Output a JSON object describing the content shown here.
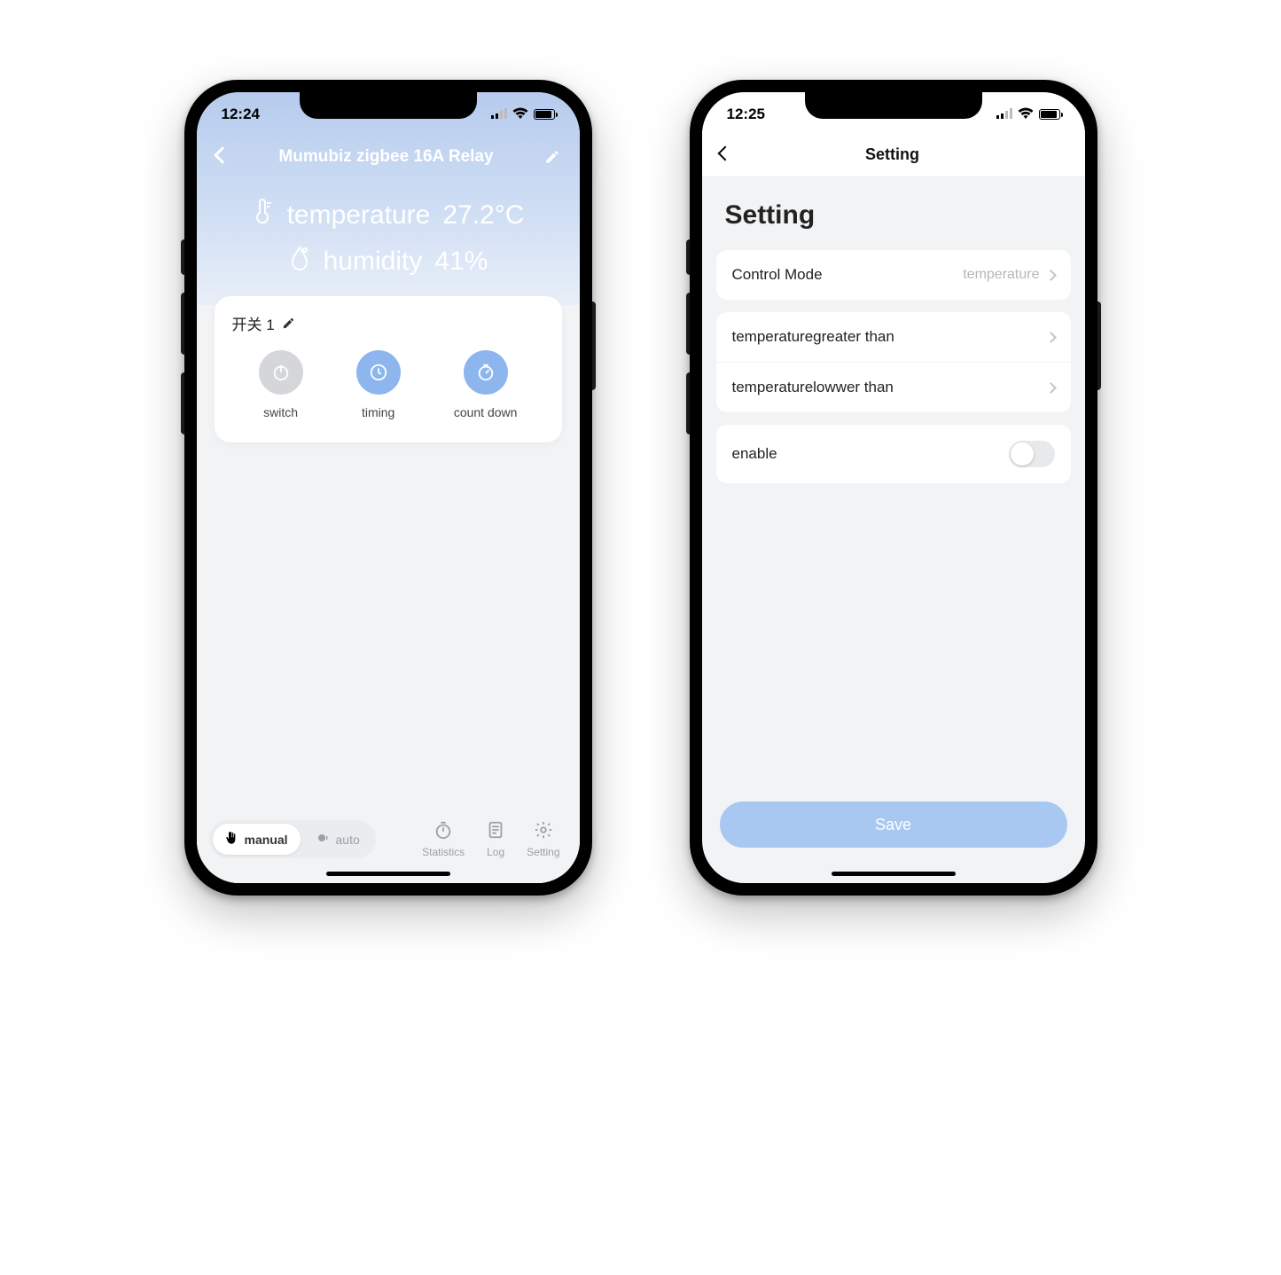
{
  "screen1": {
    "status": {
      "time": "12:24"
    },
    "header": {
      "title": "Mumubiz zigbee 16A Relay"
    },
    "readings": {
      "temperature_label": "temperature",
      "temperature_value": "27.2°C",
      "humidity_label": "humidity",
      "humidity_value": "41%"
    },
    "card": {
      "title": "开关 1",
      "actions": {
        "switch": "switch",
        "timing": "timing",
        "count_down": "count down"
      }
    },
    "bottom_nav": {
      "manual": "manual",
      "auto": "auto",
      "statistics": "Statistics",
      "log": "Log",
      "setting": "Setting"
    }
  },
  "screen2": {
    "status": {
      "time": "12:25"
    },
    "header": {
      "title": "Setting"
    },
    "heading": "Setting",
    "rows": {
      "control_mode_label": "Control Mode",
      "control_mode_value": "temperature",
      "temp_greater": "temperaturegreater than",
      "temp_lower": "temperaturelowwer than",
      "enable": "enable"
    },
    "enable_on": false,
    "save": "Save"
  },
  "colors": {
    "accent_blue": "#8db5ee",
    "save_blue": "#a9c8f1",
    "gradient_top": "#b6cbed"
  }
}
